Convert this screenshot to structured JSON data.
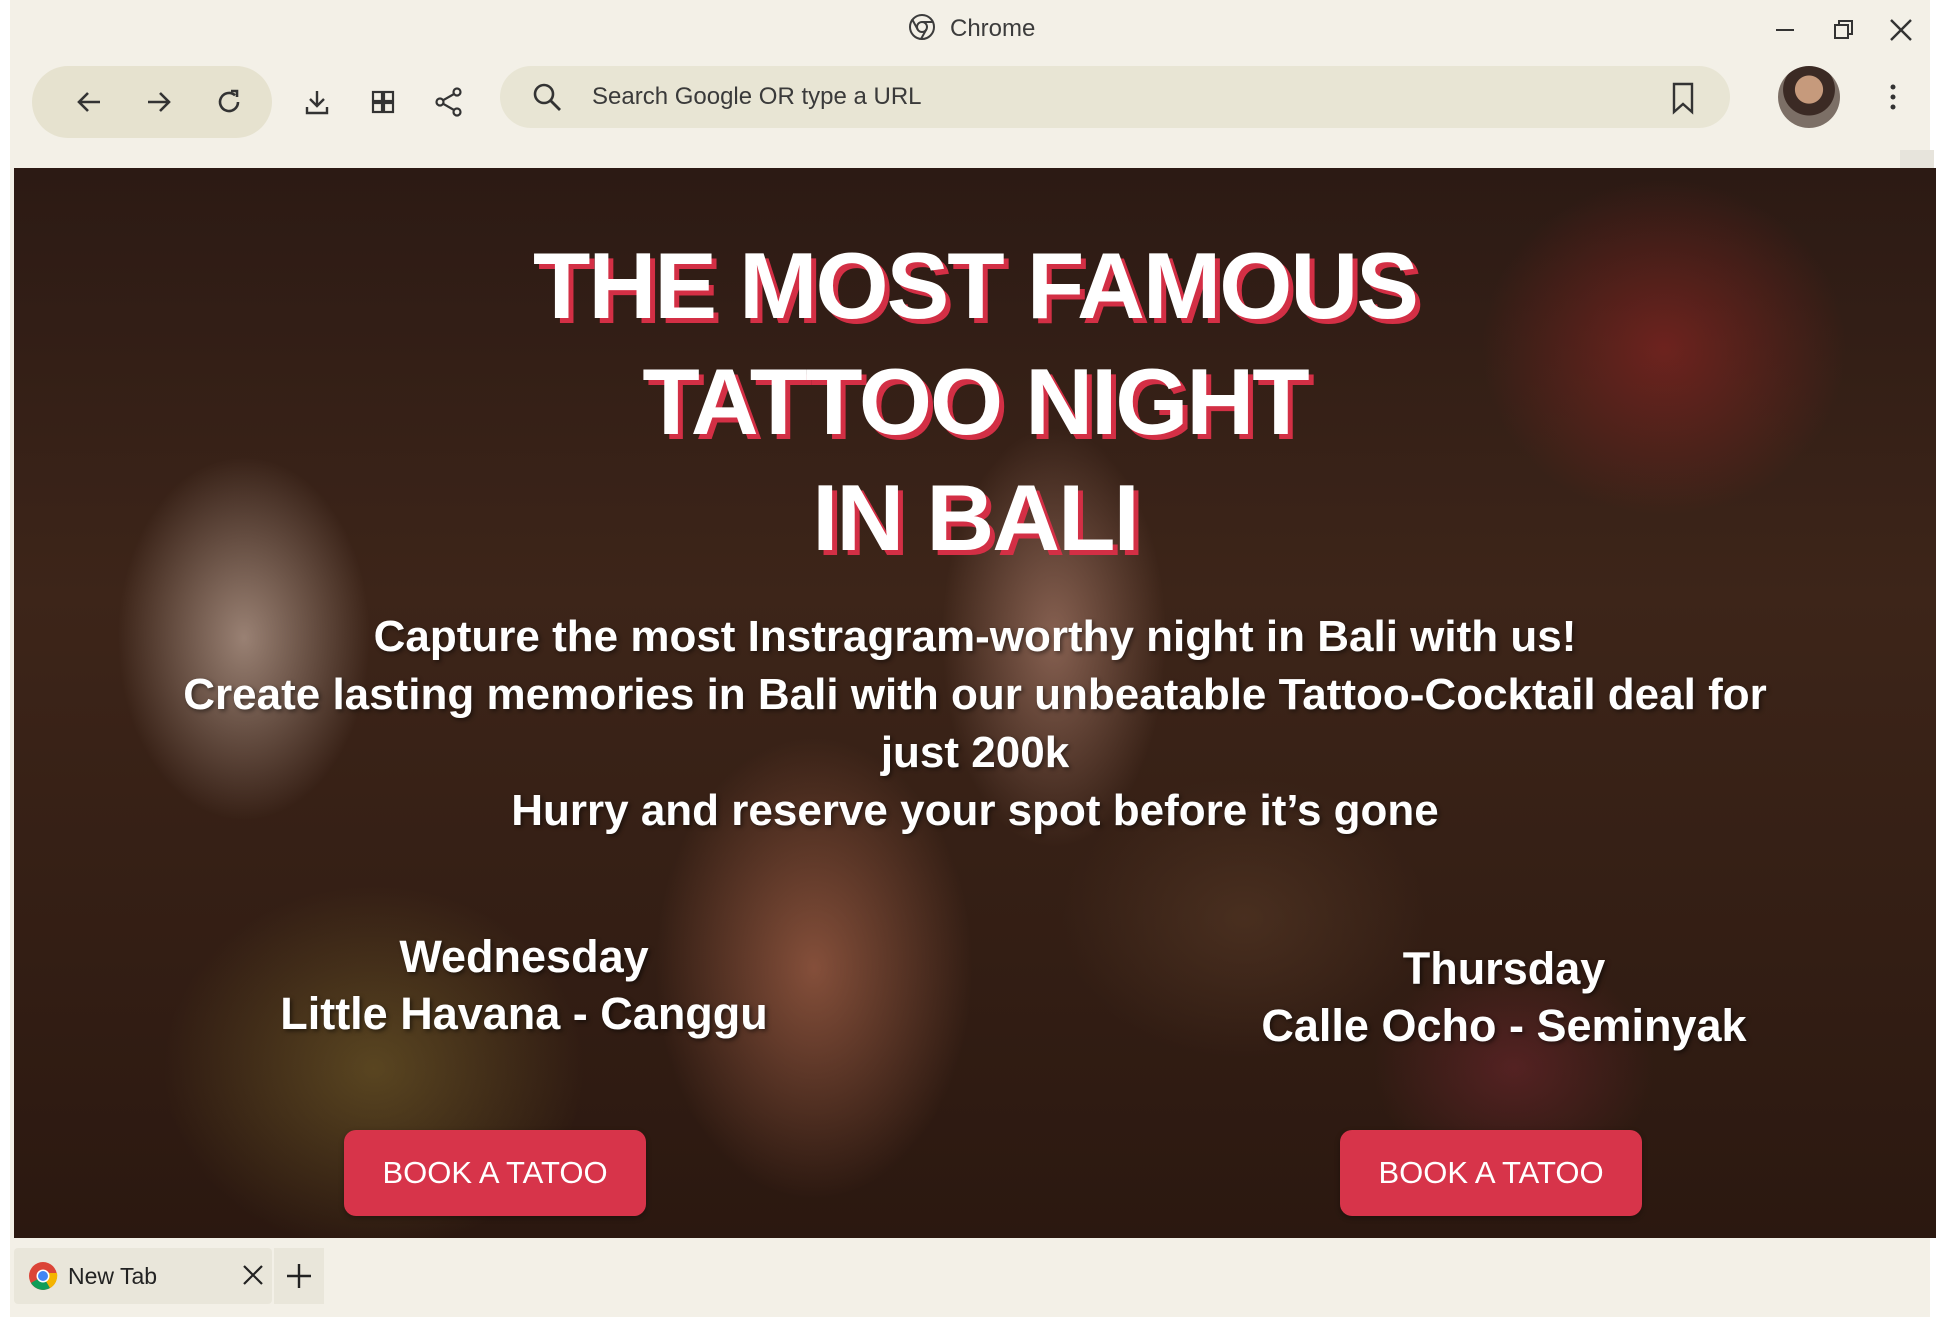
{
  "window": {
    "title": "Chrome"
  },
  "toolbar": {
    "omnibox_placeholder": "Search Google OR type a URL"
  },
  "page": {
    "title_lines": [
      "THE MOST FAMOUS",
      "TATTOO NIGHT",
      "IN BALI"
    ],
    "description_lines": [
      "Capture the most Instragram-worthy night in Bali with us!",
      "Create lasting memories in Bali with our unbeatable Tattoo-Cocktail deal for",
      "just 200k",
      "Hurry and reserve your spot before it’s gone"
    ],
    "events": [
      {
        "day": "Wednesday",
        "location": "Little Havana - Canggu",
        "button": "BOOK A TATOO"
      },
      {
        "day": "Thursday",
        "location": "Calle Ocho - Seminyak",
        "button": "BOOK A TATOO"
      }
    ]
  },
  "tabs": [
    {
      "label": "New Tab"
    }
  ],
  "colors": {
    "accent": "#d7344a",
    "chrome_bg": "#f3f0e7"
  },
  "icons": [
    "chrome-icon",
    "minimize-icon",
    "restore-icon",
    "close-icon",
    "back-icon",
    "forward-icon",
    "reload-icon",
    "download-icon",
    "extensions-icon",
    "share-icon",
    "search-icon",
    "bookmark-icon",
    "more-icon",
    "new-tab-icon"
  ]
}
